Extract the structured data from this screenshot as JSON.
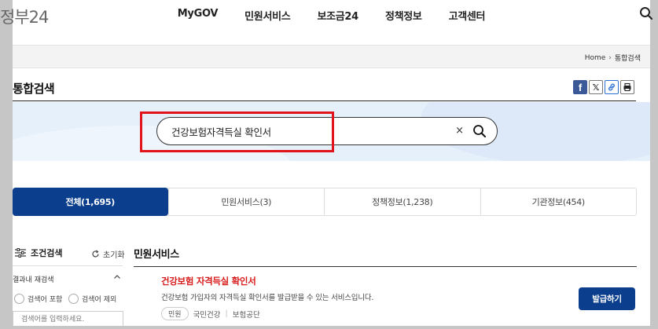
{
  "logo": {
    "text": "정부",
    "number": "24"
  },
  "gnb": {
    "items": [
      "MyGOV",
      "민원서비스",
      "보조금24",
      "정책정보",
      "고객센터"
    ]
  },
  "breadcrumb": {
    "home": "Home",
    "separator": "›",
    "current": "통합검색"
  },
  "page": {
    "title": "통합검색"
  },
  "share": {
    "icons": [
      "facebook-icon",
      "x-icon",
      "link-icon",
      "print-icon"
    ]
  },
  "search": {
    "value": "건강보험자격득실 확인서",
    "clear_label": "×"
  },
  "tabs": [
    {
      "label": "전체(1,695)",
      "active": true
    },
    {
      "label": "민원서비스(3)",
      "active": false
    },
    {
      "label": "정책정보(1,238)",
      "active": false
    },
    {
      "label": "기관정보(454)",
      "active": false
    }
  ],
  "filter": {
    "title": "조건검색",
    "reset_label": "초기화",
    "re_search_label": "결과내 재검색",
    "include_label": "검색어 포함",
    "exclude_label": "검색어 제외",
    "input_placeholder": "검색어를 입력하세요."
  },
  "results": {
    "section_title": "민원서비스",
    "item": {
      "title": "건강보험 자격득실 확인서",
      "description": "건강보험 가입자의 자격득실 확인서를 발급받을 수 있는 서비스입니다.",
      "tag": "민원",
      "meta_left": "국민건강",
      "meta_sep": "|",
      "meta_right": "보험공단",
      "button_label": "발급하기"
    }
  },
  "colors": {
    "primary": "#0b3e8c",
    "highlight": "#e2141b",
    "result_title": "#d81b1b",
    "hero": "#e6f0fb"
  }
}
